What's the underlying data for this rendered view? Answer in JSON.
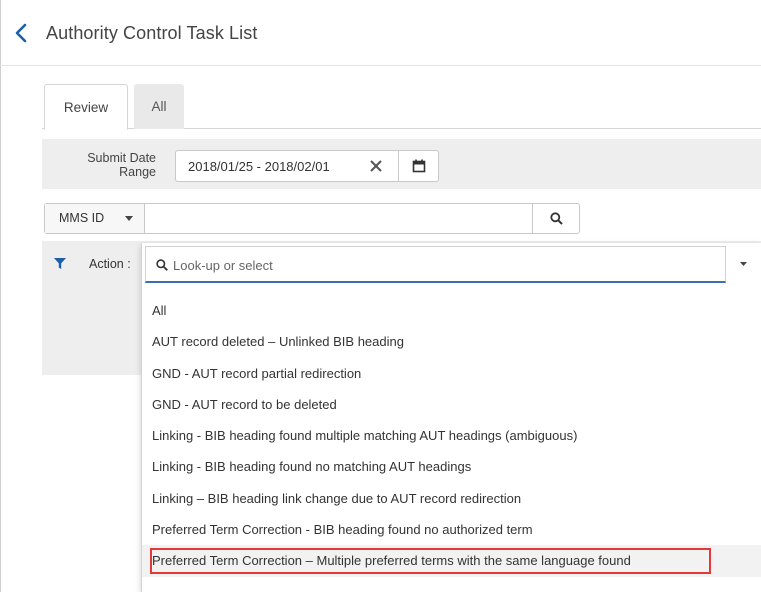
{
  "header": {
    "title": "Authority Control Task List"
  },
  "tabs": [
    {
      "label": "Review",
      "active": true
    },
    {
      "label": "All",
      "active": false
    }
  ],
  "date_filter": {
    "label_line1": "Submit Date",
    "label_line2": "Range",
    "value": "2018/01/25 - 2018/02/01"
  },
  "search": {
    "field_select": "MMS ID",
    "value": ""
  },
  "action_filter": {
    "label": "Action :",
    "placeholder": "Look-up or select"
  },
  "dropdown_options": [
    "All",
    "AUT record deleted – Unlinked BIB heading",
    "GND - AUT record partial redirection",
    "GND - AUT record to be deleted",
    "Linking - BIB heading found multiple matching AUT headings (ambiguous)",
    "Linking - BIB heading found no matching AUT headings",
    "Linking – BIB heading link change due to AUT record redirection",
    "Preferred Term Correction - BIB heading found no authorized term",
    "Preferred Term Correction – Multiple preferred terms with the same language found"
  ],
  "highlighted_option_index": 8,
  "colors": {
    "accent": "#1a5fa8",
    "highlight_border": "#e03a3a",
    "filter_bar_bg": "#eeeeee"
  }
}
